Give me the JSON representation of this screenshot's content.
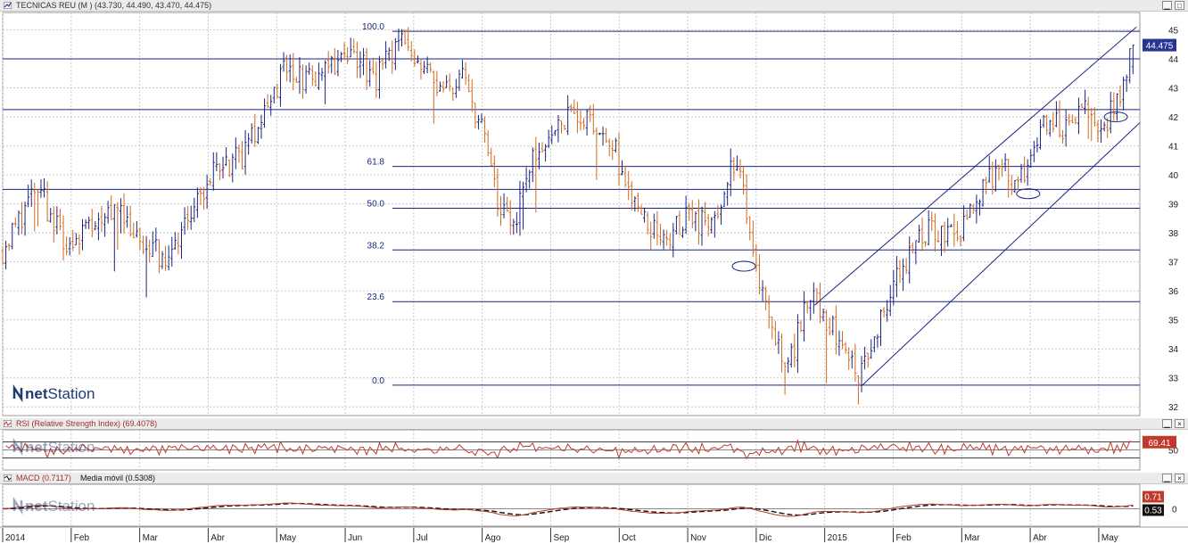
{
  "panels": {
    "price": {
      "title": "TECNICAS REU (M ) (43.730, 44.490, 43.470, 44.475)",
      "last_value": "44.475"
    },
    "rsi": {
      "title": "RSI (Relative Strength Index) (69.4078)",
      "last_value": "69.41",
      "mid_label": "50"
    },
    "macd": {
      "title": "MACD (0.7117)",
      "signal_title": "Media móvil (0.5308)",
      "macd_value": "0.71",
      "signal_value": "0.53",
      "zero_label": "0"
    }
  },
  "watermark": {
    "brand_prefix": "net",
    "brand_suffix": "Station"
  },
  "window_buttons": {
    "minimize": "▫",
    "maximize": "▫"
  },
  "colors": {
    "up_bar": "#1a237e",
    "down_bar": "#d2691e",
    "rsi_line": "#c0392b",
    "macd_line": "#c0392b",
    "signal_line": "#111111",
    "last_value_bg": "#283593",
    "grid": "#c8c8c8"
  },
  "chart_data": {
    "type": "ohlc",
    "title": "TECNICAS REU (M )",
    "last_bar": {
      "open": 43.73,
      "high": 44.49,
      "low": 43.47,
      "close": 44.475
    },
    "ylim": [
      31.7,
      45.6
    ],
    "y_ticks": [
      32,
      33,
      34,
      35,
      36,
      37,
      38,
      39,
      40,
      41,
      42,
      43,
      44,
      45
    ],
    "x_labels": [
      "2014",
      "Feb",
      "Mar",
      "Abr",
      "May",
      "Jun",
      "Jul",
      "Ago",
      "Sep",
      "Oct",
      "Nov",
      "Dic",
      "2015",
      "Feb",
      "Mar",
      "Abr",
      "May"
    ],
    "x_range_months": [
      0,
      16.6
    ],
    "anchor_closes": [
      [
        0.0,
        37.4
      ],
      [
        0.5,
        39.6
      ],
      [
        0.9,
        37.6
      ],
      [
        1.3,
        38.4
      ],
      [
        1.7,
        39.1
      ],
      [
        2.0,
        37.5
      ],
      [
        2.4,
        37.2
      ],
      [
        2.75,
        38.7
      ],
      [
        3.1,
        40.2
      ],
      [
        3.5,
        40.6
      ],
      [
        3.9,
        42.3
      ],
      [
        4.1,
        43.6
      ],
      [
        4.45,
        43.2
      ],
      [
        4.8,
        43.7
      ],
      [
        5.1,
        44.2
      ],
      [
        5.45,
        43.3
      ],
      [
        5.8,
        44.6
      ],
      [
        6.1,
        43.9
      ],
      [
        6.4,
        42.7
      ],
      [
        6.7,
        43.4
      ],
      [
        7.0,
        41.6
      ],
      [
        7.25,
        38.8
      ],
      [
        7.45,
        38.2
      ],
      [
        7.7,
        40.4
      ],
      [
        8.0,
        41.4
      ],
      [
        8.3,
        42.2
      ],
      [
        8.6,
        41.9
      ],
      [
        8.9,
        41.2
      ],
      [
        9.1,
        39.6
      ],
      [
        9.4,
        38.2
      ],
      [
        9.7,
        37.9
      ],
      [
        10.0,
        38.5
      ],
      [
        10.2,
        38.3
      ],
      [
        10.45,
        38.8
      ],
      [
        10.65,
        40.4
      ],
      [
        10.8,
        39.6
      ],
      [
        11.05,
        36.4
      ],
      [
        11.3,
        34.2
      ],
      [
        11.5,
        33.5
      ],
      [
        11.75,
        35.9
      ],
      [
        12.0,
        35.2
      ],
      [
        12.25,
        34.0
      ],
      [
        12.5,
        33.2
      ],
      [
        12.7,
        34.3
      ],
      [
        13.0,
        36.3
      ],
      [
        13.3,
        37.4
      ],
      [
        13.55,
        38.3
      ],
      [
        13.8,
        37.9
      ],
      [
        14.05,
        38.3
      ],
      [
        14.3,
        39.6
      ],
      [
        14.6,
        40.3
      ],
      [
        14.8,
        39.3
      ],
      [
        15.05,
        41.1
      ],
      [
        15.3,
        41.9
      ],
      [
        15.55,
        41.5
      ],
      [
        15.8,
        42.4
      ],
      [
        16.05,
        41.6
      ],
      [
        16.3,
        42.6
      ],
      [
        16.45,
        44.0
      ],
      [
        16.5,
        44.475
      ]
    ],
    "fibonacci": {
      "high": 44.95,
      "low": 32.75,
      "levels": [
        {
          "label": "100.0",
          "ratio": 1.0
        },
        {
          "label": "61.8",
          "ratio": 0.618
        },
        {
          "label": "50.0",
          "ratio": 0.5
        },
        {
          "label": "38.2",
          "ratio": 0.382
        },
        {
          "label": "23.6",
          "ratio": 0.236
        },
        {
          "label": "0.0",
          "ratio": 0.0
        }
      ]
    },
    "horizontal_lines": [
      44.0,
      42.25,
      39.5
    ],
    "channel": {
      "lower": [
        [
          12.55,
          32.75
        ],
        [
          16.6,
          41.8
        ]
      ],
      "upper": [
        [
          11.85,
          35.5
        ],
        [
          16.55,
          45.1
        ]
      ]
    },
    "markers": [
      {
        "month": 10.82,
        "price": 36.85
      },
      {
        "month": 14.97,
        "price": 39.35
      },
      {
        "month": 16.25,
        "price": 42.0
      }
    ],
    "rsi": {
      "last": 69.41,
      "ylim": [
        0,
        100
      ],
      "levels": [
        30,
        50,
        70
      ]
    },
    "macd": {
      "macd_last": 0.71,
      "signal_last": 0.53,
      "zero": 0
    }
  }
}
